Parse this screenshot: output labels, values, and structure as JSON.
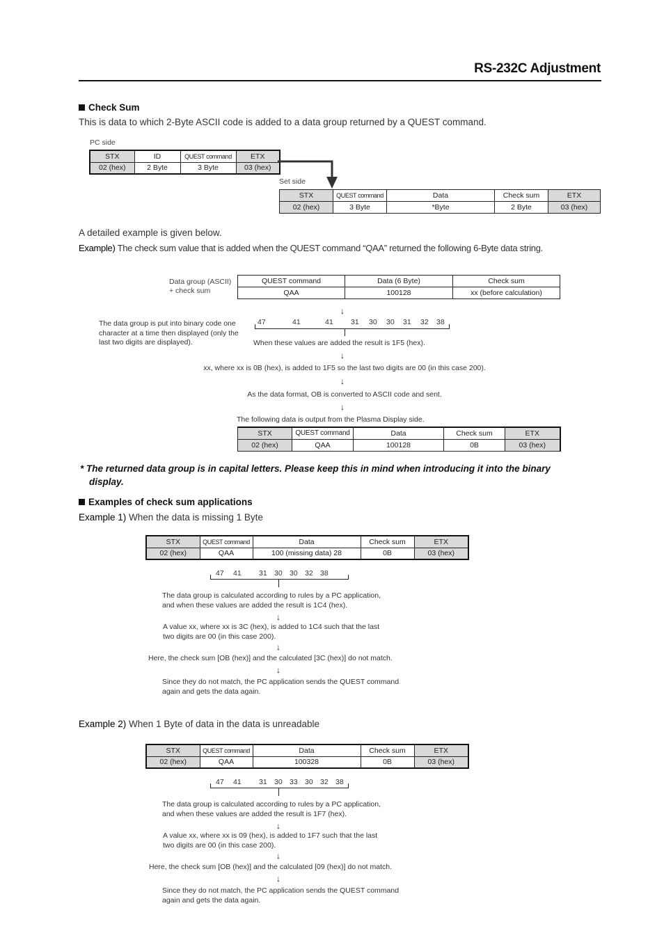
{
  "header": {
    "title": "RS-232C Adjustment"
  },
  "check_sum": {
    "heading": "Check Sum",
    "intro": "This is data to which 2-Byte ASCII code is added to a data group returned by a QUEST command.",
    "pc_side": {
      "label": "PC side",
      "headers": [
        "STX",
        "ID",
        "QUEST command",
        "ETX"
      ],
      "values": [
        "02 (hex)",
        "2 Byte",
        "3 Byte",
        "03 (hex)"
      ]
    },
    "set_side": {
      "label": "Set side",
      "headers": [
        "STX",
        "QUEST command",
        "Data",
        "Check sum",
        "ETX"
      ],
      "values": [
        "02 (hex)",
        "3 Byte",
        "*Byte",
        "2 Byte",
        "03 (hex)"
      ]
    },
    "detail_intro": "A detailed example is given below.",
    "example_label": "Example)",
    "example_text": "The check sum value that is added when the QUEST command “QAA” returned the following 6-Byte data string.",
    "data_group": {
      "label_line1": "Data group (ASCII)",
      "label_line2": "+ check sum",
      "headers": [
        "QUEST command",
        "Data (6 Byte)",
        "Check sum"
      ],
      "values": [
        "QAA",
        "100128",
        "xx (before calculation)"
      ]
    },
    "binary_note": [
      "The data group is put into binary code one",
      "character at a time then displayed (only the",
      "last two digits are displayed)."
    ],
    "binary_values": [
      "47",
      "41",
      "41",
      "31",
      "30",
      "30",
      "31",
      "32",
      "38"
    ],
    "steps": [
      "When these values are added the result is 1F5 (hex).",
      "xx, where xx is 0B (hex), is added to 1F5 so the last two digits are 00 (in this case 200).",
      "As the data format, OB is converted to ASCII code and sent.",
      "The following data is output from the Plasma Display side."
    ],
    "output_table": {
      "headers": [
        "STX",
        "QUEST command",
        "Data",
        "Check sum",
        "ETX"
      ],
      "values": [
        "02 (hex)",
        "QAA",
        "100128",
        "0B",
        "03 (hex)"
      ]
    },
    "note_line1": "*  The returned data group is in capital letters. Please keep this in mind when introducing it into the binary",
    "note_line2": "display."
  },
  "applications": {
    "heading": "Examples of check sum applications",
    "example1": {
      "label": "Example 1)",
      "title": "When the data is missing 1 Byte",
      "headers": [
        "STX",
        "QUEST command",
        "Data",
        "Check sum",
        "ETX"
      ],
      "values": [
        "02 (hex)",
        "QAA",
        "100 (missing data) 28",
        "0B",
        "03 (hex)"
      ],
      "binary_values": [
        "47",
        "41",
        "31",
        "30",
        "30",
        "32",
        "38"
      ],
      "step1": [
        "The data group is calculated according to rules by a PC application,",
        "and when these values are added the result is 1C4 (hex)."
      ],
      "step2": [
        "A value xx, where xx is 3C (hex), is added to 1C4 such that the last",
        "two digits are 00 (in this case 200)."
      ],
      "step3": "Here, the check sum [OB (hex)] and the calculated [3C (hex)] do not match.",
      "step4": [
        "Since they do not match, the PC application sends the QUEST command",
        "again and gets the data again."
      ]
    },
    "example2": {
      "label": "Example 2)",
      "title": "When 1 Byte of data in the data is unreadable",
      "headers": [
        "STX",
        "QUEST command",
        "Data",
        "Check sum",
        "ETX"
      ],
      "values": [
        "02 (hex)",
        "QAA",
        "100328",
        "0B",
        "03 (hex)"
      ],
      "binary_values": [
        "47",
        "41",
        "31",
        "30",
        "33",
        "30",
        "32",
        "38"
      ],
      "step1": [
        "The data group is calculated according to rules by a PC application,",
        "and when these values are added the result is 1F7 (hex)."
      ],
      "step2": [
        "A value xx, where xx is 09 (hex), is added to 1F7 such that the last",
        "two digits are 00 (in this case 200)."
      ],
      "step3": "Here, the check sum [OB (hex)] and the calculated [09 (hex)] do not match.",
      "step4": [
        "Since they do not match, the PC application sends the QUEST command",
        "again and gets the data again."
      ]
    }
  },
  "icons": {
    "down_arrow": "↓",
    "square_bullet": "square-bullet"
  }
}
